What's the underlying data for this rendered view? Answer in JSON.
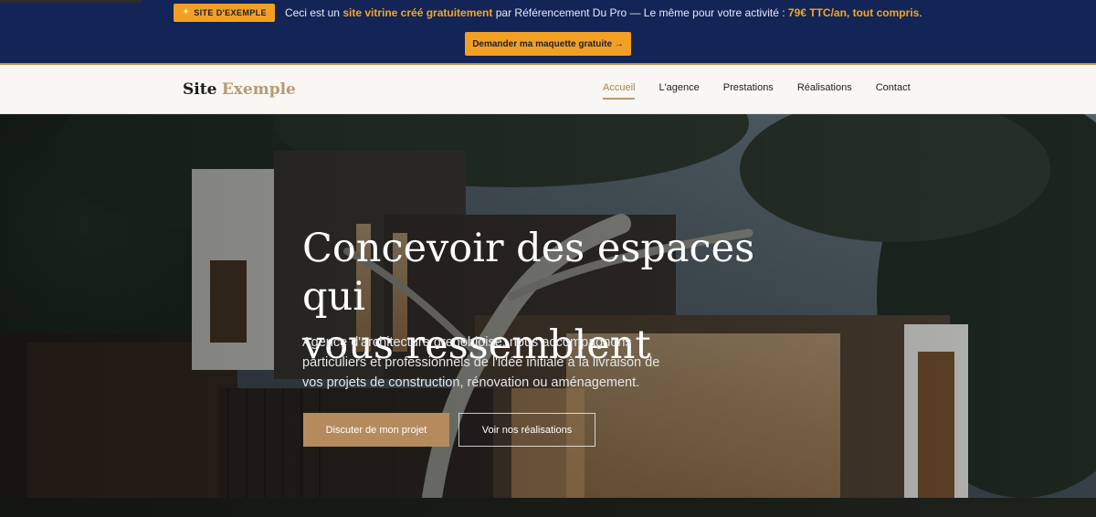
{
  "promo": {
    "badge_icon": "sparkle-icon",
    "badge_label": "SITE D'EXEMPLE",
    "text_before": "Ceci est un",
    "text_highlight_1": "site vitrine créé gratuitement",
    "text_middle": "par Référencement Du Pro — Le même pour votre activité :",
    "text_highlight_2": "79€ TTC/an, tout compris",
    "text_end": ".",
    "cta_label": "Demander ma maquette gratuite →",
    "colors": {
      "banner": "#132456",
      "accent": "#f2a024"
    }
  },
  "header": {
    "logo_part1": "Site",
    "logo_part2": "Exemple",
    "nav": [
      {
        "label": "Accueil",
        "active": true
      },
      {
        "label": "L'agence",
        "active": false
      },
      {
        "label": "Prestations",
        "active": false
      },
      {
        "label": "Réalisations",
        "active": false
      },
      {
        "label": "Contact",
        "active": false
      }
    ],
    "colors": {
      "background": "#f8f7f3",
      "brand_accent": "#b89a72"
    }
  },
  "hero": {
    "title_line1": "Concevoir des espaces qui",
    "title_line2": "vous ressemblent",
    "subtitle": "Agence d'architecture grenobloise, nous accompagnons particuliers et professionnels de l'idée initiale à la livraison de vos projets de construction, rénovation ou aménagement.",
    "primary_button": "Discuter de mon projet",
    "secondary_button": "Voir nos réalisations",
    "background_image": "modern-house-at-dusk",
    "colors": {
      "primary_button": "#b58b5e"
    }
  }
}
